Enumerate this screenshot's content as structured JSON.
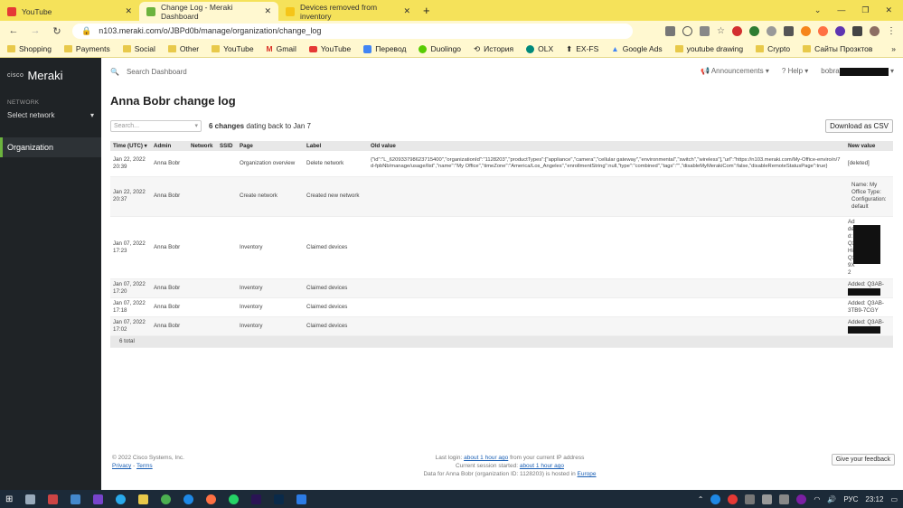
{
  "browser": {
    "tabs": [
      {
        "title": "YouTube",
        "color": "#e53935"
      },
      {
        "title": "Change Log - Meraki Dashboard",
        "color": "#6cb33e"
      },
      {
        "title": "Devices removed from inventory",
        "color": "#f5c518"
      }
    ],
    "url": "n103.meraki.com/o/JBPd0b/manage/organization/change_log",
    "bookmarks": [
      "Shopping",
      "Payments",
      "Social",
      "Other",
      "YouTube",
      "Gmail",
      "YouTube",
      "Перевод",
      "Duolingo",
      "История",
      "OLX",
      "EX-FS",
      "Google Ads",
      "youtube drawing",
      "Crypto",
      "Сайты Прозктов"
    ]
  },
  "sidebar": {
    "brand_small": "cisco",
    "brand": "Meraki",
    "network_label": "NETWORK",
    "select_network": "Select network",
    "org_item": "Organization"
  },
  "topbar": {
    "search_placeholder": "Search Dashboard",
    "announcements": "Announcements",
    "help": "Help",
    "user": "bobra"
  },
  "page": {
    "title": "Anna Bobr change log",
    "search_placeholder": "Search...",
    "count_bold": "6 changes",
    "count_rest": "dating back to Jan 7",
    "csv_button": "Download as CSV"
  },
  "table": {
    "headers": [
      "Time (UTC)",
      "Admin",
      "Network",
      "SSID",
      "Page",
      "Label",
      "Old value",
      "New value"
    ],
    "rows": [
      {
        "time": "Jan 22, 2022 20:39",
        "admin": "Anna Bobr",
        "page": "Organization overview",
        "label": "Delete network",
        "old": "{\"id\":\"L_620933798623715400\",\"organizationId\":\"1128203\",\"productTypes\":[\"appliance\",\"camera\",\"cellular gateway\",\"environmental\",\"switch\",\"wireless\"],\"url\":\"https://n103.meraki.com/My-Office-enviro/n/7d-fpbNb/manage/usage/list\",\"name\":\"My Office\",\"timeZone\":\"America/Los_Angeles\",\"enrollmentString\":null,\"type\":\"combined\",\"tags\":\"\",\"disableMyMerakiCom\":false,\"disableRemoteStatusPage\":true}",
        "new": "[deleted]"
      },
      {
        "time": "Jan 22, 2022 20:37",
        "admin": "Anna Bobr",
        "page": "Create network",
        "label": "Created new network",
        "old": "",
        "new": "Name: My Office Type: Configuration: default"
      },
      {
        "time": "Jan 07, 2022 17:23",
        "admin": "Anna Bobr",
        "page": "Inventory",
        "label": "Claimed devices",
        "old": "",
        "new": "Added: Q3 Hi Q3 9X 2"
      },
      {
        "time": "Jan 07, 2022 17:20",
        "admin": "Anna Bobr",
        "page": "Inventory",
        "label": "Claimed devices",
        "old": "",
        "new": "Added: Q3AB-"
      },
      {
        "time": "Jan 07, 2022 17:18",
        "admin": "Anna Bobr",
        "page": "Inventory",
        "label": "Claimed devices",
        "old": "",
        "new": "Added: Q3AB-3TB9-7CGY"
      },
      {
        "time": "Jan 07, 2022 17:02",
        "admin": "Anna Bobr",
        "page": "Inventory",
        "label": "Claimed devices",
        "old": "",
        "new": "Added: Q3AB-"
      }
    ],
    "total": "6 total"
  },
  "footer": {
    "copyright": "© 2022 Cisco Systems, Inc.",
    "privacy": "Privacy",
    "terms": "Terms",
    "last_login_prefix": "Last login:",
    "last_login_link": "about 1 hour ago",
    "last_login_suffix": "from your current IP address",
    "session_prefix": "Current session started:",
    "session_link": "about 1 hour ago",
    "data_text": "Data for Anna Bobr (organization ID: 1128203) is hosted in",
    "data_link": "Europe",
    "feedback": "Give your feedback"
  },
  "taskbar": {
    "lang": "РУС",
    "time": "23:12"
  }
}
